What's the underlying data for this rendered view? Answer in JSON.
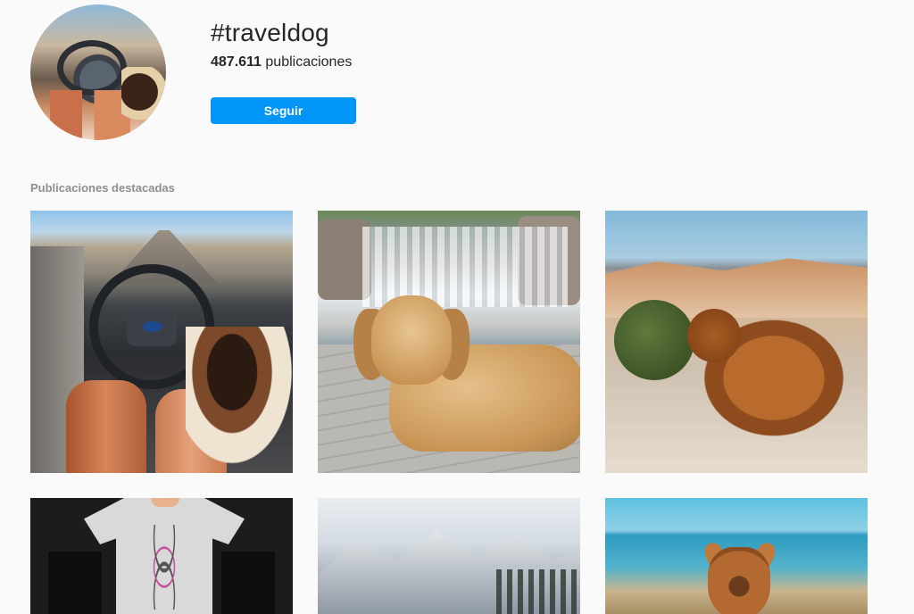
{
  "header": {
    "hashtag": "#traveldog",
    "post_count": "487.611",
    "post_count_suffix": " publicaciones",
    "follow_label": "Seguir"
  },
  "top_posts": {
    "title": "Publicaciones destacadas"
  },
  "colors": {
    "accent": "#0095f6",
    "background": "#fafafa",
    "text": "#262626",
    "secondary_text": "#8e8e8e"
  }
}
